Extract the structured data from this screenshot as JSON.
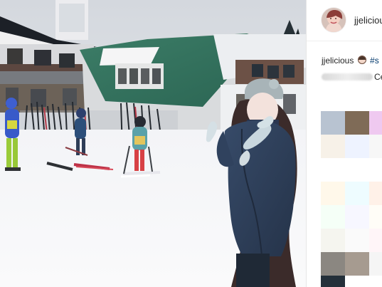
{
  "post": {
    "username": "jjelicious",
    "caption": {
      "username": "jjelicious",
      "emoji_icon": "face-emoji-icon",
      "tag": "#s"
    },
    "comment": {
      "suffix": "Ce"
    }
  },
  "colors": {
    "username_text": "#262626",
    "caption_tag": "#00376b",
    "sky": "#dfe3e8",
    "roof": "#2f6f58",
    "snow": "#f4f4f6",
    "jacket": "#2d3d57",
    "hat": "#a8b3b7"
  },
  "sidebar": {
    "avatar_icon": "avatar-icon",
    "comment_blur": "redacted-comment"
  },
  "pixel_grid": {
    "cells": [
      "#b8c3d1",
      "#7f6b57",
      "#efc9f0",
      "#f7f1e8",
      "#eef3ff",
      "#f7f7f7",
      "#ffffff",
      "#ffffff",
      "#ffffff",
      "#fff8ea",
      "#eefcff",
      "#fff1e8",
      "#f5fff7",
      "#f7f7ff",
      "#fffdf7",
      "#f5f5ef",
      "#fafafa",
      "#fff5f8",
      "#8b8781",
      "#a69b90",
      "#f5f5f5",
      "#24303a",
      "#ffffff",
      "#ffffff"
    ]
  }
}
